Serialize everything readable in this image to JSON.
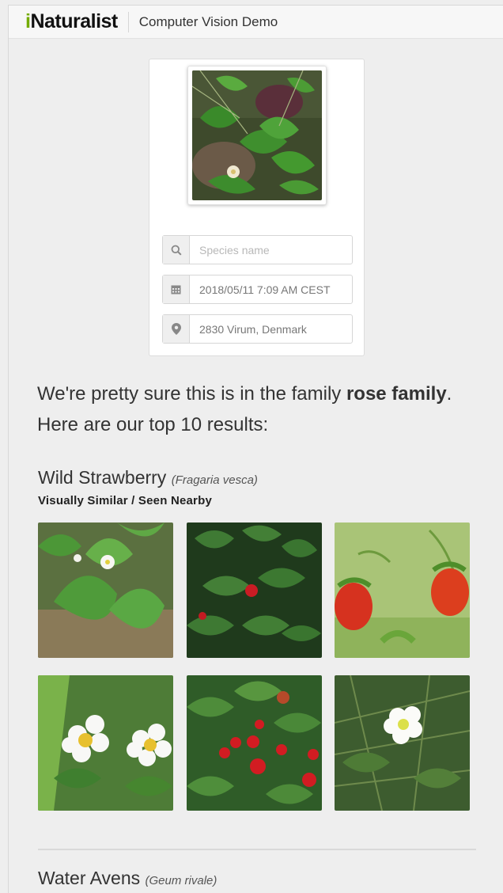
{
  "header": {
    "logo_i": "i",
    "logo_rest": "Naturalist",
    "title": "Computer Vision Demo"
  },
  "upload": {
    "species_placeholder": "Species name",
    "date_value": "2018/05/11 7:09 AM CEST",
    "location_value": "2830 Virum, Denmark"
  },
  "summary": {
    "prefix": "We're pretty sure this is in the family ",
    "family": "rose family",
    "suffix": ". Here are our top 10 results:"
  },
  "results": [
    {
      "common_name": "Wild Strawberry",
      "scientific_name": "(Fragaria vesca)",
      "subtitle": "Visually Similar / Seen Nearby"
    },
    {
      "common_name": "Water Avens",
      "scientific_name": "(Geum rivale)"
    }
  ],
  "colors": {
    "brand_green": "#74ac00",
    "background": "#eeeeee"
  },
  "icons": {
    "search": "search-icon",
    "date": "calendar-icon",
    "location": "map-marker-icon"
  }
}
